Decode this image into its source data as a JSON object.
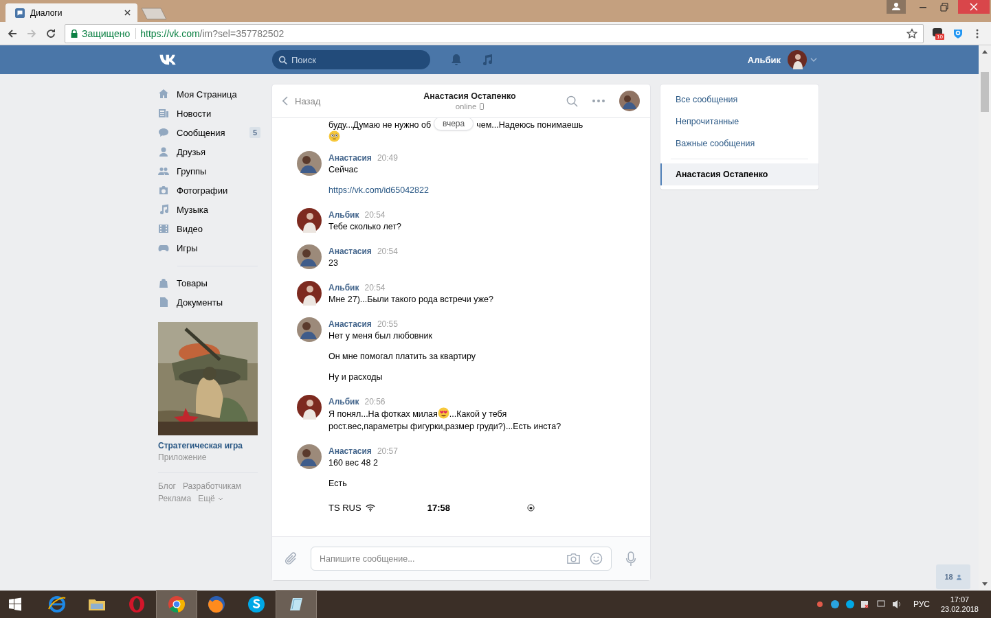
{
  "browser": {
    "tab_title": "Диалоги",
    "secure_label": "Защищено",
    "url_host": "https://vk.com",
    "url_path": "/im?sel=357782502",
    "extension_badge": "10"
  },
  "header": {
    "search_placeholder": "Поиск",
    "user_name": "Альбик"
  },
  "nav": [
    {
      "label": "Моя Страница"
    },
    {
      "label": "Новости"
    },
    {
      "label": "Сообщения",
      "badge": "5"
    },
    {
      "label": "Друзья"
    },
    {
      "label": "Группы"
    },
    {
      "label": "Фотографии"
    },
    {
      "label": "Музыка"
    },
    {
      "label": "Видео"
    },
    {
      "label": "Игры"
    }
  ],
  "nav_more": [
    {
      "label": "Товары"
    },
    {
      "label": "Документы"
    }
  ],
  "app": {
    "kind": "picture",
    "title": "Стратегическая игра",
    "subtitle": "Приложение"
  },
  "footer_links": [
    "Блог",
    "Разработчикам",
    "Реклама",
    "Ещё"
  ],
  "chat": {
    "back": "Назад",
    "title": "Анастасия Остапенко",
    "status": "online",
    "date_pill": "вчера",
    "cut_message": {
      "before": "буду...Думаю не нужно об",
      "after": "чем...Надеюсь понимаешь"
    },
    "messages": [
      {
        "kind": "peer",
        "author": "Анастасия",
        "time": "20:49",
        "lines": [
          [
            {
              "kind": "text",
              "text": "Сейчас"
            }
          ],
          [
            {
              "kind": "link",
              "text": "https://vk.com/id65042822"
            }
          ]
        ]
      },
      {
        "kind": "self",
        "author": "Альбик",
        "time": "20:54",
        "lines": [
          [
            {
              "kind": "text",
              "text": "Тебе сколько лет?"
            }
          ]
        ]
      },
      {
        "kind": "peer",
        "author": "Анастасия",
        "time": "20:54",
        "lines": [
          [
            {
              "kind": "text",
              "text": "23"
            }
          ]
        ]
      },
      {
        "kind": "self",
        "author": "Альбик",
        "time": "20:54",
        "lines": [
          [
            {
              "kind": "text",
              "text": "Мне 27)...Были такого рода встречи уже?"
            }
          ]
        ]
      },
      {
        "kind": "peer",
        "author": "Анастасия",
        "time": "20:55",
        "lines": [
          [
            {
              "kind": "text",
              "text": "Нет у меня был любовник"
            }
          ],
          [
            {
              "kind": "text",
              "text": "Он мне помогал платить за квартиру"
            }
          ],
          [
            {
              "kind": "text",
              "text": "Ну и расходы"
            }
          ]
        ]
      },
      {
        "kind": "self",
        "author": "Альбик",
        "time": "20:56",
        "lines": [
          [
            {
              "kind": "text",
              "text": "Я понял...На фотках милая"
            },
            {
              "kind": "emoji"
            },
            {
              "kind": "text",
              "text": "...Какой у тебя"
            },
            {
              "kind": "break"
            },
            {
              "kind": "text",
              "text": "рост.вес,параметры фигурки,размер груди?)...Есть инста?"
            }
          ]
        ]
      },
      {
        "kind": "peer",
        "author": "Анастасия",
        "time": "20:57",
        "lines": [
          [
            {
              "kind": "text",
              "text": "160 вес 48 2"
            }
          ],
          [
            {
              "kind": "text",
              "text": "Есть"
            }
          ]
        ]
      }
    ],
    "attachment": {
      "carrier": "TS RUS",
      "time": "17:58"
    },
    "composer_placeholder": "Напишите сообщение..."
  },
  "filters": [
    {
      "label": "Все сообщения",
      "selected": false
    },
    {
      "label": "Непрочитанные",
      "selected": false
    },
    {
      "label": "Важные сообщения",
      "selected": false
    },
    {
      "label": "Анастасия Остапенко",
      "selected": true
    }
  ],
  "online_count": "18",
  "taskbar": {
    "language": "РУС",
    "time": "17:07",
    "date": "23.02.2018"
  }
}
